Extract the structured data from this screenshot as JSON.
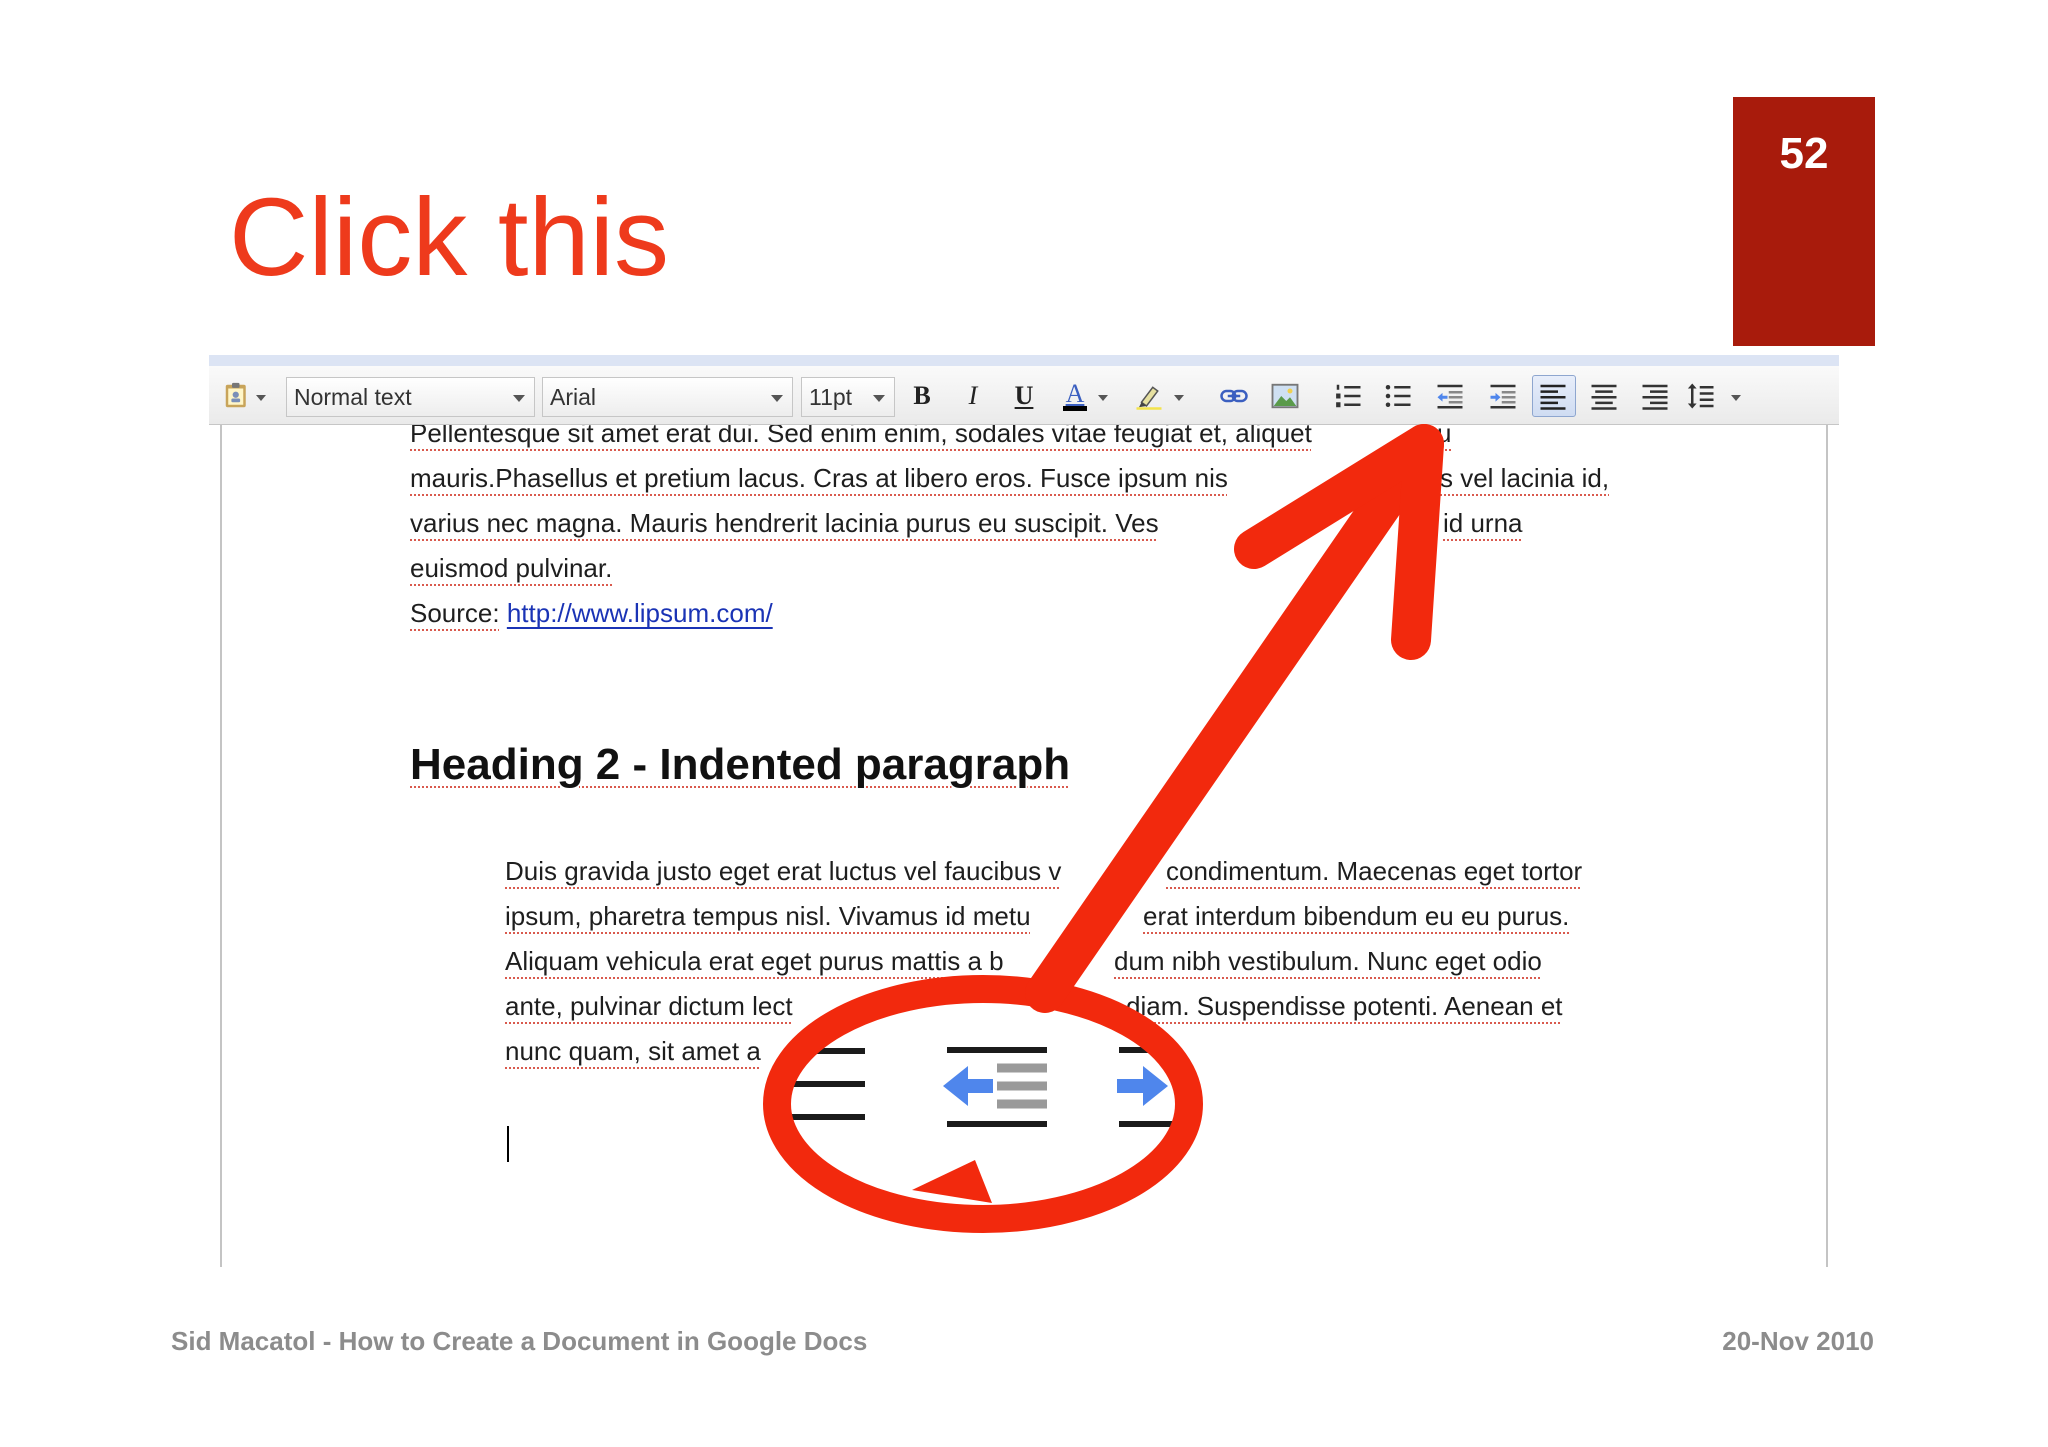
{
  "slide": {
    "number": "52",
    "title": "Click this"
  },
  "toolbar": {
    "paragraph_style": "Normal text",
    "font_family": "Arial",
    "font_size": "11pt",
    "bold_label": "B",
    "italic_label": "I",
    "underline_label": "U",
    "text_color_label": "A",
    "icons": [
      "paint-format-icon",
      "text-color-icon",
      "highlight-icon",
      "link-icon",
      "image-icon",
      "numbered-list-icon",
      "bulleted-list-icon",
      "decrease-indent-icon",
      "increase-indent-icon",
      "align-left-icon",
      "align-center-icon",
      "align-right-icon",
      "line-spacing-icon"
    ]
  },
  "document": {
    "paragraph_lines": [
      {
        "left": "Pellentesque sit amet erat dui. Sed enim enim, sodales vitae feugiat et, aliquet",
        "right": "u"
      },
      {
        "left": "mauris.Phasellus et pretium lacus. Cras at libero eros. Fusce ipsum nis",
        "right": "s vel lacinia id,"
      },
      {
        "left": "varius nec magna. Mauris hendrerit lacinia purus eu suscipit. Ves",
        "right": "id urna"
      },
      {
        "left": "euismod pulvinar."
      }
    ],
    "source_label": "Source:",
    "source_url": "http://www.lipsum.com/",
    "heading": "Heading 2 - Indented paragraph",
    "indented_lines": [
      {
        "left": "Duis gravida justo eget erat luctus vel faucibus v",
        "right": "condimentum. Maecenas eget tortor"
      },
      {
        "left": "ipsum, pharetra tempus nisl. Vivamus id metu",
        "right": "erat interdum bibendum eu eu purus."
      },
      {
        "left": "Aliquam vehicula erat eget purus mattis a b",
        "right": "dum nibh vestibulum. Nunc eget odio"
      },
      {
        "left": "ante, pulvinar dictum lect",
        "right": "diam. Suspendisse potenti. Aenean et"
      },
      {
        "left": "nunc quam, sit amet a"
      }
    ]
  },
  "footer": {
    "author_title": "Sid Macatol - How to Create a Document in Google Docs",
    "date": "20-Nov 2010"
  },
  "colors": {
    "title": "#ee3a1c",
    "slide_number_box": "#a81b0c",
    "annotation": "#f2290d",
    "footer_text": "#8c8c8c",
    "link": "#1a33b5",
    "indent_arrow": "#4f86ec"
  }
}
